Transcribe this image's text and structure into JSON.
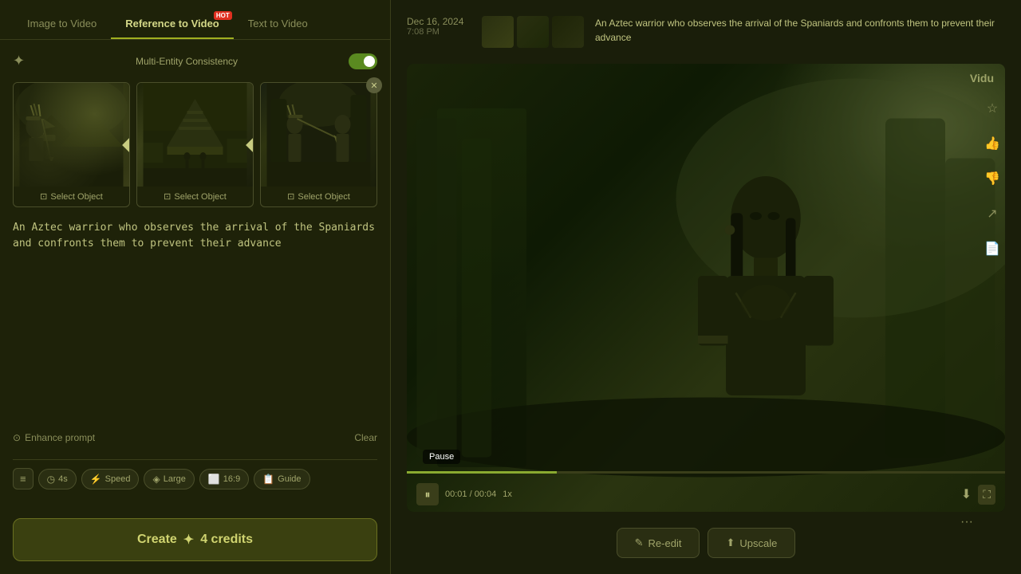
{
  "tabs": [
    {
      "label": "Image to Video",
      "active": false
    },
    {
      "label": "Reference to Video",
      "active": true,
      "hot": true
    },
    {
      "label": "Text to Video",
      "active": false
    }
  ],
  "multiEntity": {
    "label": "Multi-Entity Consistency",
    "enabled": true
  },
  "imageCards": [
    {
      "id": 1,
      "alt": "Aztec warrior observing ships"
    },
    {
      "id": 2,
      "alt": "Aztec pyramid scene"
    },
    {
      "id": 3,
      "alt": "Confrontation scene"
    }
  ],
  "selectObjectLabel": "Select Object",
  "prompt": {
    "text": "An Aztec warrior who observes the arrival of the Spaniards and confronts them to prevent their advance"
  },
  "enhancePrompt": "Enhance prompt",
  "clearLabel": "Clear",
  "settings": {
    "duration": "4s",
    "speed": "Speed",
    "quality": "Large",
    "ratio": "16:9",
    "guide": "Guide"
  },
  "createBtn": {
    "label": "Create",
    "credits": "4 credits",
    "sparkle": "✦"
  },
  "history": {
    "date": "Dec 16, 2024",
    "time": "7:08 PM",
    "description": "An Aztec warrior who observes the arrival of the Spaniards and confronts them to prevent their advance"
  },
  "video": {
    "brandLabel": "Vidu",
    "pauseLabel": "Pause",
    "currentTime": "00:01",
    "totalTime": "00:04",
    "speed": "1x",
    "progress": 25
  },
  "actions": {
    "reedit": "Re-edit",
    "upscale": "Upscale"
  }
}
